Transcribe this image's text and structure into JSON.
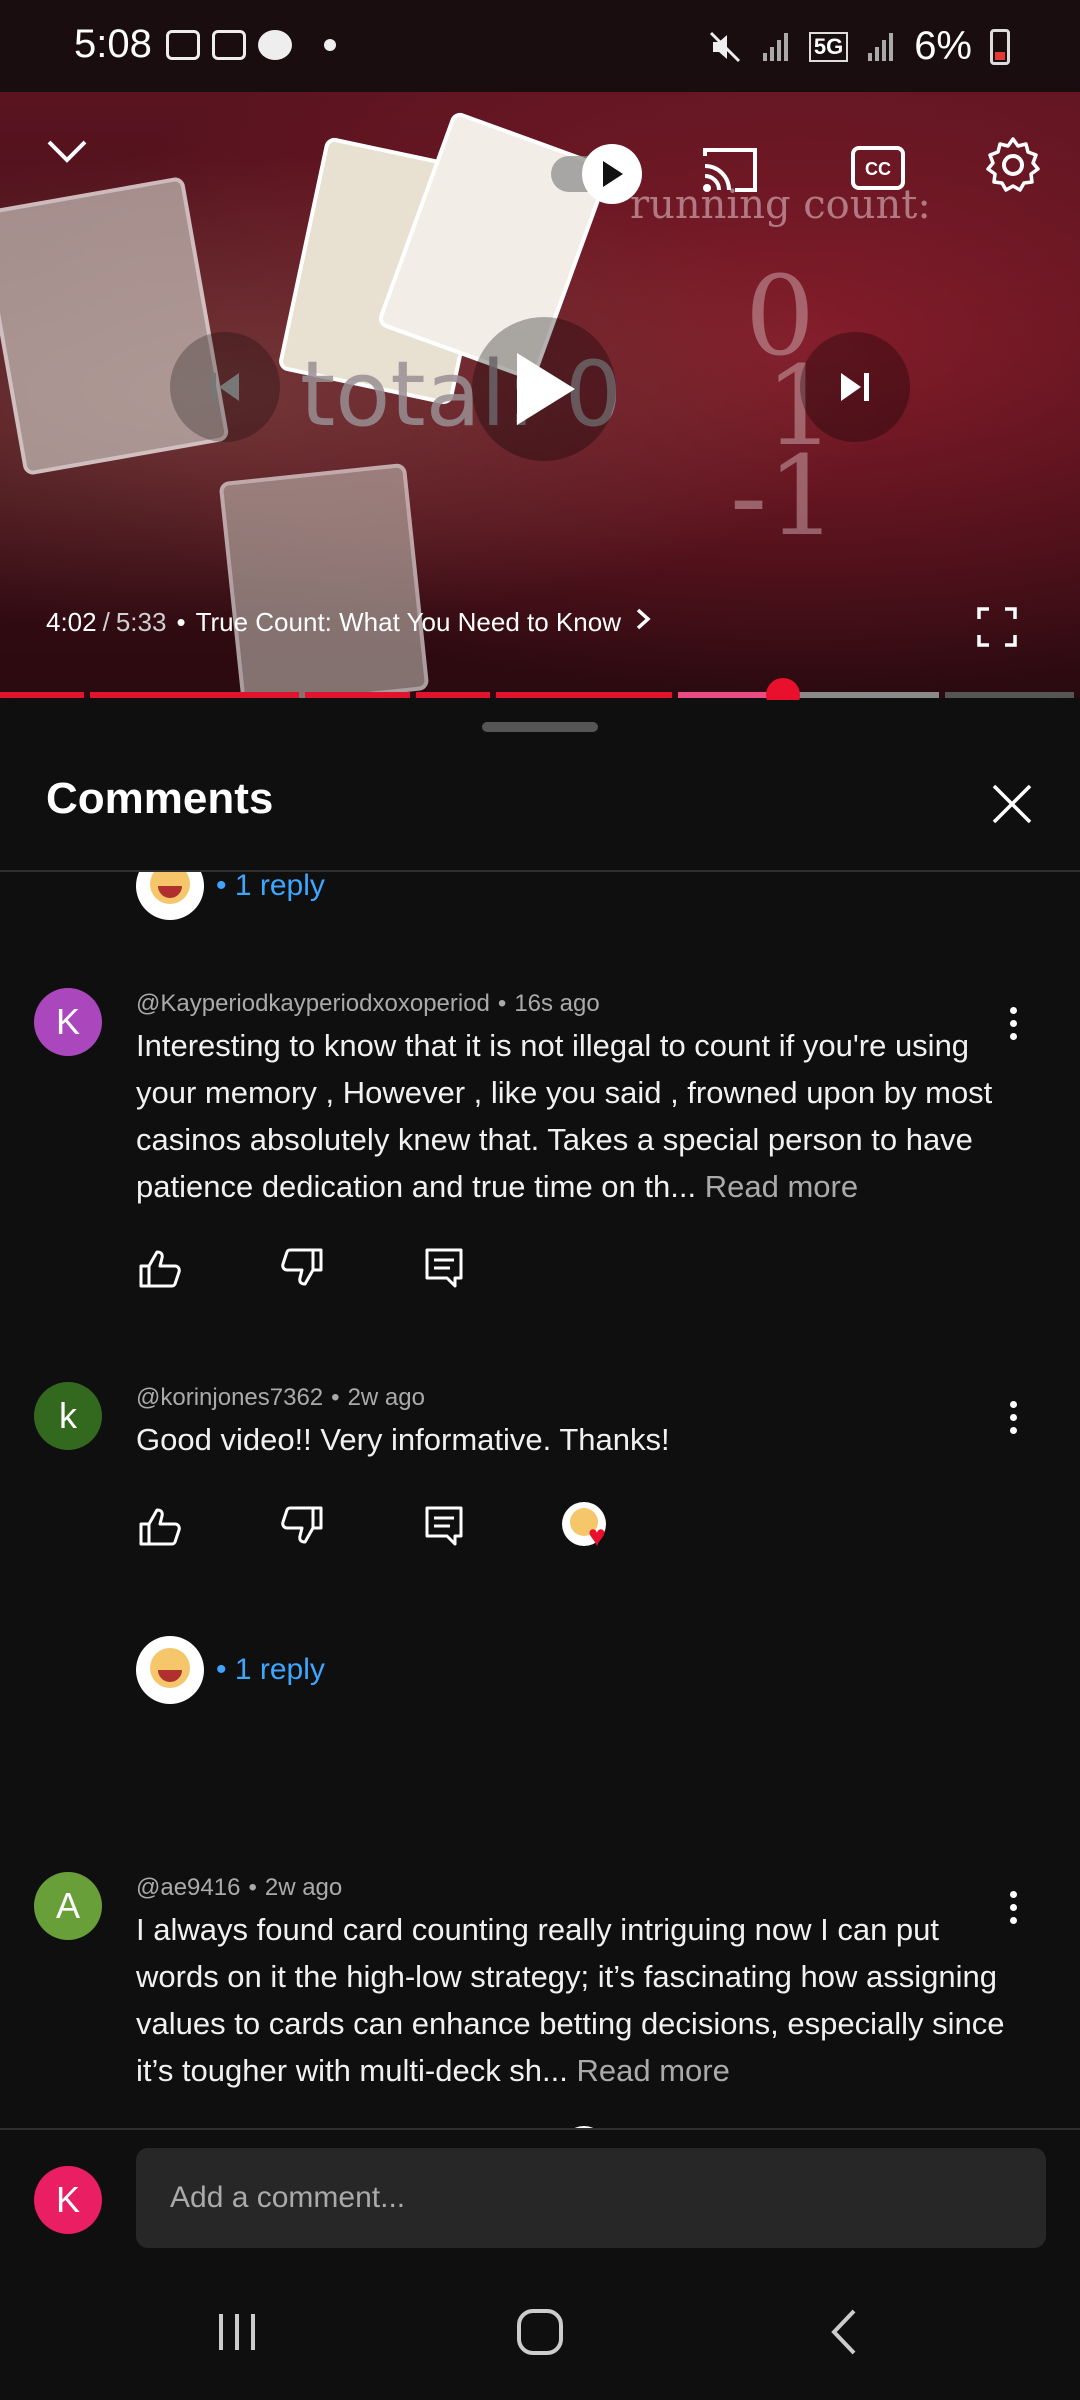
{
  "status": {
    "time": "5:08",
    "battery": "6%",
    "network": "5G"
  },
  "video": {
    "current_time": "4:02",
    "separator": "/",
    "total_time": "5:33",
    "bullet": "•",
    "chapter_title": "True Count: What You Need to Know",
    "overlay_total_text": "total: 0",
    "overlay_running_count": "running count:",
    "overlay_numbers": [
      "0",
      "1",
      "-1"
    ],
    "progress_played_fraction": 0.727
  },
  "sheet": {
    "title": "Comments"
  },
  "comments": [
    {
      "id": "partial-top",
      "reply_text": "• 1 reply"
    },
    {
      "avatar_letter": "K",
      "avatar_color": "#ab47bc",
      "author": "@Kayperiodkayperiodxoxoperiod",
      "time": "16s ago",
      "body": "Interesting to know that it is not illegal to count if you're using your memory , However , like you said , frowned upon by most casinos absolutely knew that. Takes a special person to have patience dedication and true time on th...",
      "read_more": "Read more"
    },
    {
      "avatar_letter": "k",
      "avatar_color": "#33691e",
      "author": "@korinjones7362",
      "time": "2w ago",
      "body": "Good video!! Very informative. Thanks!",
      "reply_text": "• 1 reply"
    },
    {
      "avatar_letter": "A",
      "avatar_color": "#689f38",
      "author": "@ae9416",
      "time": "2w ago",
      "body": "I always found card counting really intriguing now I can put words on it the high-low strategy; it’s fascinating how assigning values to cards can enhance betting decisions, especially since it’s tougher with multi-deck sh...",
      "read_more": "Read more"
    }
  ],
  "composer": {
    "avatar_letter": "K",
    "placeholder": "Add a comment..."
  },
  "colors": {
    "accent_red": "#e0142d",
    "link_blue": "#3ea6ff"
  },
  "icons": [
    "chevron-down-icon",
    "autoplay-toggle",
    "cast-icon",
    "cc-icon",
    "settings-gear-icon",
    "skip-previous-icon",
    "play-icon",
    "skip-next-icon",
    "fullscreen-icon",
    "close-icon",
    "thumbs-up-icon",
    "thumbs-down-icon",
    "reply-icon",
    "kebab-menu-icon"
  ]
}
